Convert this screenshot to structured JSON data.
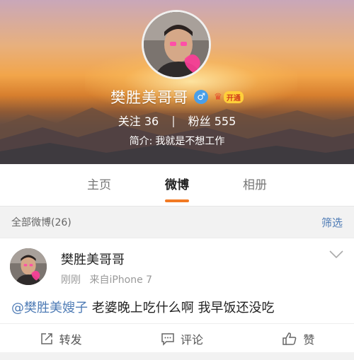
{
  "profile": {
    "username": "樊胜美哥哥",
    "gender_symbol": "♂",
    "vip_label": "开通",
    "following_label": "关注",
    "following_count": "36",
    "separator": "|",
    "followers_label": "粉丝",
    "followers_count": "555",
    "bio_label": "简介:",
    "bio_text": "我就是不想工作"
  },
  "tabs": [
    {
      "label": "主页",
      "active": false
    },
    {
      "label": "微博",
      "active": true
    },
    {
      "label": "相册",
      "active": false
    }
  ],
  "filter_bar": {
    "all_posts_label": "全部微博(26)",
    "filter_label": "筛选"
  },
  "post": {
    "author": "樊胜美哥哥",
    "time": "刚刚",
    "source": "来自iPhone 7",
    "mention": "@樊胜美嫂子",
    "text": " 老婆晚上吃什么啊 我早饭还没吃"
  },
  "actions": {
    "repost_label": "转发",
    "comment_label": "评论",
    "like_label": "赞"
  },
  "colors": {
    "accent_orange": "#f27a23",
    "link_blue": "#4e7bb5",
    "gender_blue": "#4a9fe8",
    "vip_yellow": "#ffcf3a"
  },
  "icons": {
    "gender": "male-icon",
    "vip": "crown-icon",
    "dropdown": "chevron-down-icon",
    "repost": "share-icon",
    "comment": "comment-icon",
    "like": "thumbs-up-icon"
  }
}
